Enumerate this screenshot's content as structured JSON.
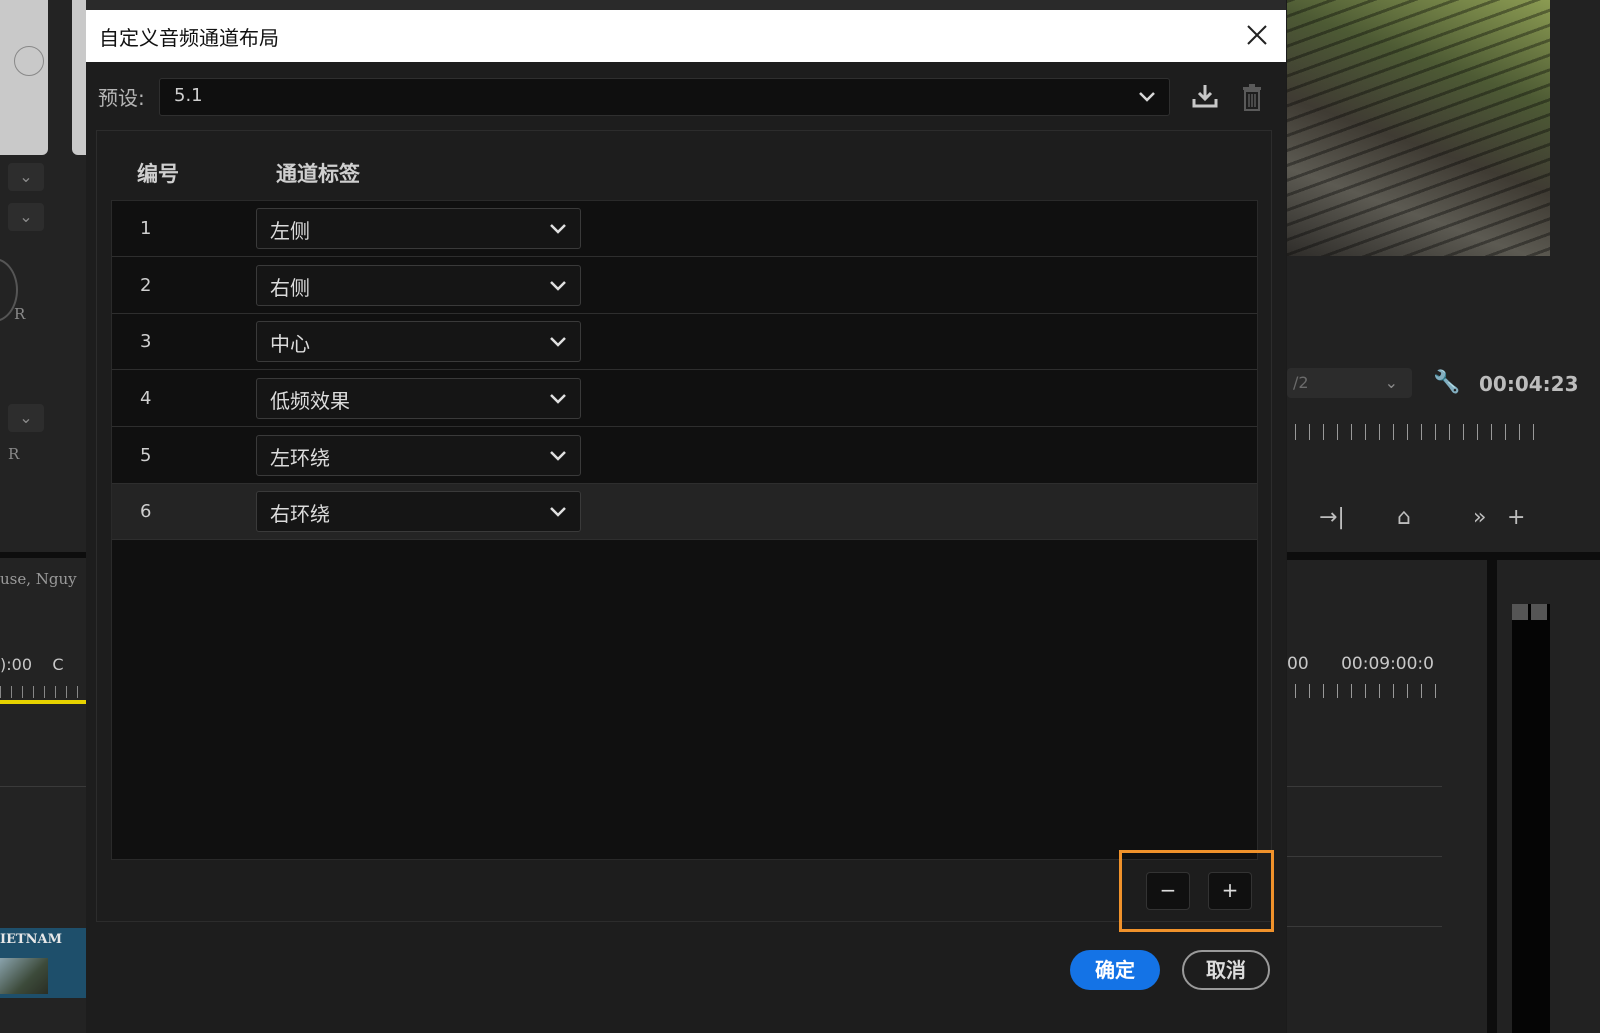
{
  "dialog": {
    "title": "自定义音频通道布局",
    "close_icon": "close-icon"
  },
  "preset": {
    "label": "预设:",
    "value": "5.1",
    "icons": [
      "chevron-down-icon",
      "save-preset-icon",
      "delete-preset-icon"
    ]
  },
  "table": {
    "headers": {
      "number": "编号",
      "channel_label": "通道标签"
    },
    "rows": [
      {
        "number": "1",
        "label": "左侧"
      },
      {
        "number": "2",
        "label": "右侧"
      },
      {
        "number": "3",
        "label": "中心"
      },
      {
        "number": "4",
        "label": "低频效果"
      },
      {
        "number": "5",
        "label": "左环绕"
      },
      {
        "number": "6",
        "label": "右环绕"
      }
    ],
    "selected_row": 6
  },
  "controls": {
    "remove_label": "−",
    "add_label": "+"
  },
  "footer": {
    "ok_label": "确定",
    "cancel_label": "取消"
  },
  "background_app": {
    "left_clip_text": "use, Nguy",
    "left_timecode": "):00",
    "left_timecode_2": "C",
    "thumb_label": "IETNAM",
    "left_r1": "R",
    "left_r2": "R",
    "right_select_value": "/2",
    "right_timecode": "00:04:23",
    "right_ruler_a": "00",
    "right_ruler_b": "00:09:00:0"
  },
  "colors": {
    "accent_blue": "#1473e6",
    "highlight_orange": "#f0922b",
    "dialog_bg": "#1d1d1d",
    "table_bg": "#101010",
    "titlebar_bg": "#ffffff"
  }
}
